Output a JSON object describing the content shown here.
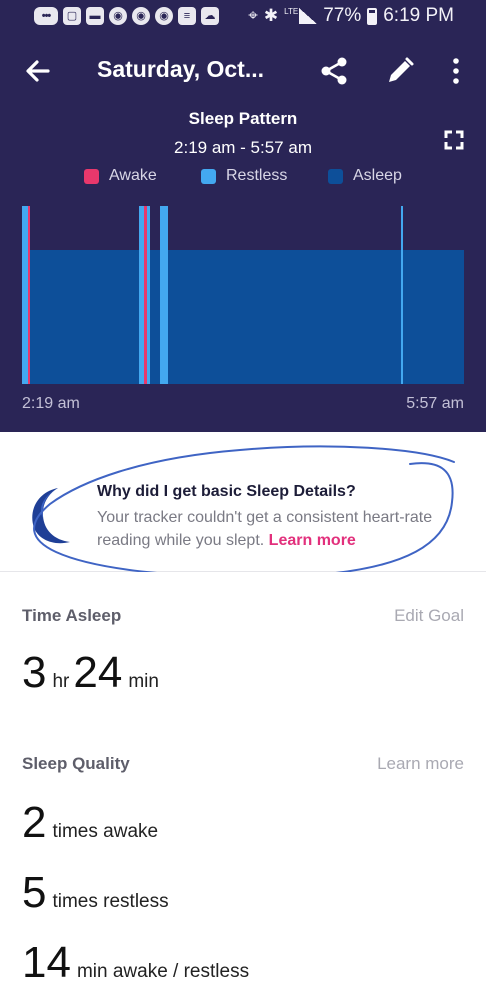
{
  "status_bar": {
    "icons": [
      "messages-icon",
      "shopping-bag-icon",
      "chat-icon",
      "chrome-icon",
      "chrome-icon",
      "chrome-icon",
      "cast-icon",
      "cloud-upload-icon"
    ],
    "battery": "77%",
    "network": "LTE",
    "time": "6:19 PM"
  },
  "toolbar": {
    "title": "Saturday, Oct..."
  },
  "sleep_pattern": {
    "title": "Sleep Pattern",
    "range": "2:19 am - 5:57 am",
    "legend": [
      {
        "label": "Awake",
        "color": "#e8386c"
      },
      {
        "label": "Restless",
        "color": "#43a8f0"
      },
      {
        "label": "Asleep",
        "color": "#0d4f99"
      }
    ],
    "axis_start": "2:19 am",
    "axis_end": "5:57 am"
  },
  "tip": {
    "heading": "Why did I get basic Sleep Details?",
    "body": "Your tracker couldn't get a consistent heart-rate reading while you slept.",
    "link": "Learn more"
  },
  "time_asleep": {
    "heading": "Time Asleep",
    "edit_goal": "Edit Goal",
    "hours": "3",
    "hours_unit": "hr",
    "minutes": "24",
    "minutes_unit": "min"
  },
  "sleep_quality": {
    "heading": "Sleep Quality",
    "learn_more": "Learn more",
    "times_awake": "2",
    "times_awake_label": "times awake",
    "times_restless": "5",
    "times_restless_label": "times restless",
    "min_awake_restless": "14",
    "min_awake_restless_label": "min awake / restless"
  },
  "colors": {
    "header_bg": "#2a2556",
    "asleep": "#0d4f99",
    "restless": "#43a8f0",
    "awake": "#e8386c",
    "link": "#e2307c"
  }
}
